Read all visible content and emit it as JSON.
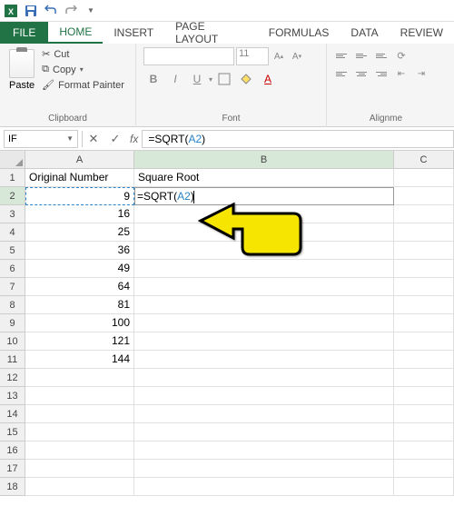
{
  "qat": {
    "save": "save-icon",
    "undo": "undo-icon",
    "redo": "redo-icon"
  },
  "tabs": {
    "file": "FILE",
    "home": "HOME",
    "insert": "INSERT",
    "page_layout": "PAGE LAYOUT",
    "formulas": "FORMULAS",
    "data": "DATA",
    "review": "REVIEW"
  },
  "ribbon": {
    "clipboard": {
      "paste": "Paste",
      "cut": "Cut",
      "copy": "Copy",
      "format_painter": "Format Painter",
      "group_label": "Clipboard"
    },
    "font": {
      "font_name_placeholder": "",
      "font_size": "11",
      "bold": "B",
      "italic": "I",
      "underline": "U",
      "group_label": "Font"
    },
    "alignment": {
      "group_label": "Alignme"
    }
  },
  "formula_bar": {
    "name_box": "IF",
    "cancel": "✕",
    "enter": "✓",
    "fx": "fx",
    "formula_prefix": "=SQRT(",
    "formula_ref": "A2",
    "formula_suffix": ")"
  },
  "columns": [
    "A",
    "B",
    "C"
  ],
  "col_widths": {
    "A": 120,
    "B": 286,
    "C": 66
  },
  "rows": [
    {
      "n": 1,
      "A": "Original Number",
      "B": "Square Root"
    },
    {
      "n": 2,
      "A": "9",
      "B_prefix": "=SQRT(",
      "B_ref": "A2",
      "B_suffix": ")"
    },
    {
      "n": 3,
      "A": "16",
      "B": ""
    },
    {
      "n": 4,
      "A": "25",
      "B": ""
    },
    {
      "n": 5,
      "A": "36",
      "B": ""
    },
    {
      "n": 6,
      "A": "49",
      "B": ""
    },
    {
      "n": 7,
      "A": "64",
      "B": ""
    },
    {
      "n": 8,
      "A": "81",
      "B": ""
    },
    {
      "n": 9,
      "A": "100",
      "B": ""
    },
    {
      "n": 10,
      "A": "121",
      "B": ""
    },
    {
      "n": 11,
      "A": "144",
      "B": ""
    },
    {
      "n": 12,
      "A": "",
      "B": ""
    },
    {
      "n": 13,
      "A": "",
      "B": ""
    },
    {
      "n": 14,
      "A": "",
      "B": ""
    },
    {
      "n": 15,
      "A": "",
      "B": ""
    },
    {
      "n": 16,
      "A": "",
      "B": ""
    },
    {
      "n": 17,
      "A": "",
      "B": ""
    },
    {
      "n": 18,
      "A": "",
      "B": ""
    }
  ],
  "colors": {
    "excel_green": "#217346",
    "ref_blue": "#2a83c7",
    "arrow_yellow": "#f5e500"
  }
}
